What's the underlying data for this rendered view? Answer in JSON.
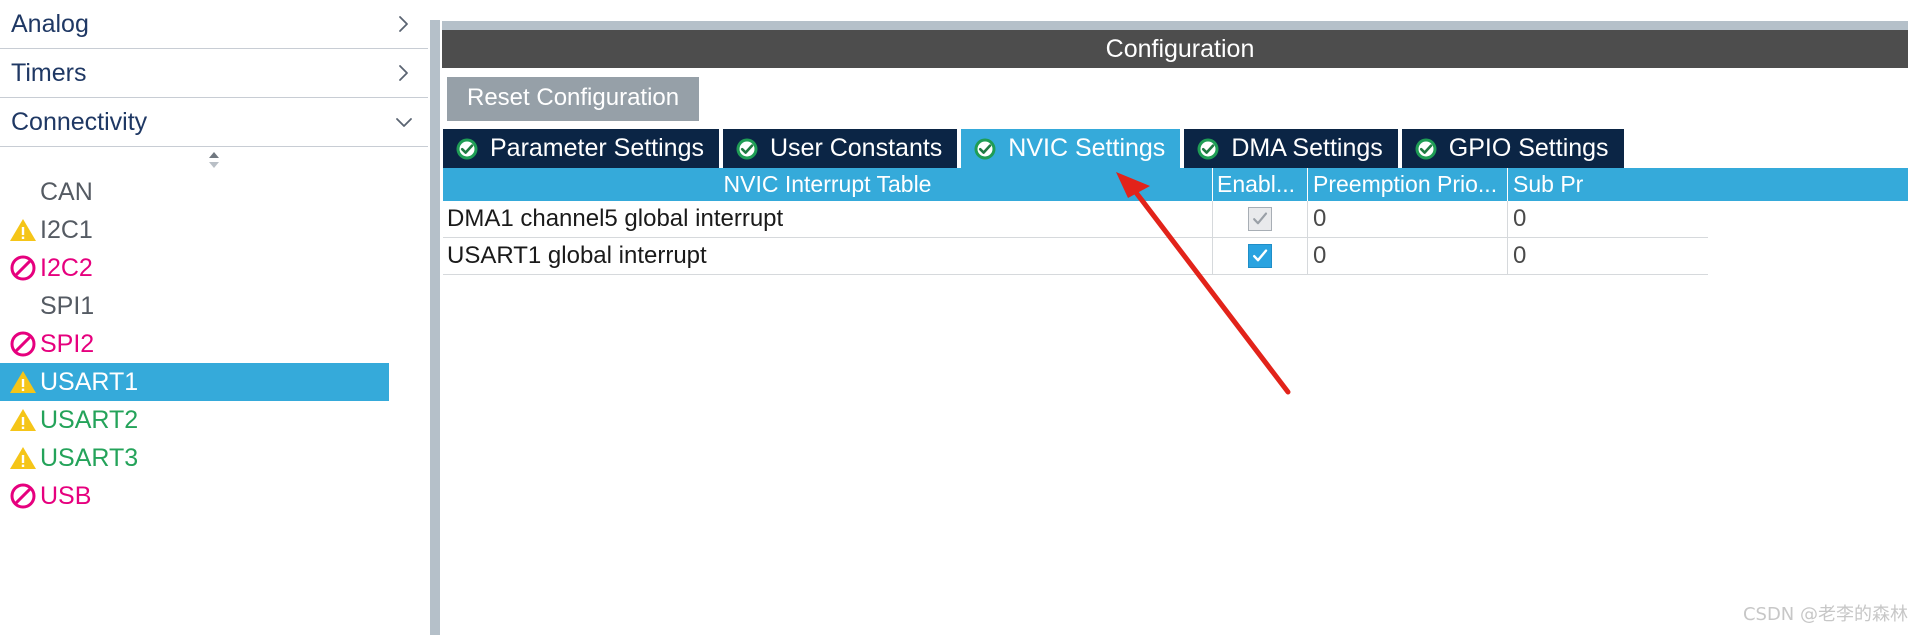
{
  "sidebar": {
    "categories": [
      {
        "label": "Analog",
        "expanded": false,
        "chevron": "chevron-right-icon"
      },
      {
        "label": "Timers",
        "expanded": false,
        "chevron": "chevron-right-icon"
      },
      {
        "label": "Connectivity",
        "expanded": true,
        "chevron": "chevron-down-icon"
      }
    ],
    "scroll_up_down_icon": "scroll-updown-icon",
    "peripherals": [
      {
        "label": "CAN",
        "status": "none",
        "icon": "",
        "selected": false
      },
      {
        "label": "I2C1",
        "status": "warning",
        "icon": "warning-icon",
        "selected": false
      },
      {
        "label": "I2C2",
        "status": "blocked",
        "icon": "blocked-icon",
        "selected": false
      },
      {
        "label": "SPI1",
        "status": "none",
        "icon": "",
        "selected": false
      },
      {
        "label": "SPI2",
        "status": "blocked",
        "icon": "blocked-icon",
        "selected": false
      },
      {
        "label": "USART1",
        "status": "warning",
        "icon": "warning-icon",
        "selected": true
      },
      {
        "label": "USART2",
        "status": "warning",
        "icon": "warning-icon",
        "selected": false
      },
      {
        "label": "USART3",
        "status": "warning",
        "icon": "warning-icon",
        "selected": false
      },
      {
        "label": "USB",
        "status": "blocked",
        "icon": "blocked-icon",
        "selected": false
      }
    ]
  },
  "panel": {
    "title": "Configuration",
    "reset_button": "Reset Configuration",
    "tabs": [
      {
        "label": "Parameter Settings",
        "icon": "check-circle-icon",
        "active": false
      },
      {
        "label": "User Constants",
        "icon": "check-circle-icon",
        "active": false
      },
      {
        "label": "NVIC Settings",
        "icon": "check-circle-icon",
        "active": true
      },
      {
        "label": "DMA Settings",
        "icon": "check-circle-icon",
        "active": false
      },
      {
        "label": "GPIO Settings",
        "icon": "check-circle-icon",
        "active": false
      }
    ],
    "table": {
      "headers": {
        "name": "NVIC Interrupt Table",
        "enabled": "Enabl...",
        "preemption": "Preemption Prio...",
        "sub": "Sub Pr"
      },
      "rows": [
        {
          "name": "DMA1 channel5 global interrupt",
          "enabled": true,
          "enabled_disabled_look": true,
          "preemption_priority": "0",
          "sub_priority": "0"
        },
        {
          "name": "USART1 global interrupt",
          "enabled": true,
          "enabled_disabled_look": false,
          "preemption_priority": "0",
          "sub_priority": "0"
        }
      ]
    }
  },
  "annotation": {
    "arrow": "red-arrow-pointer",
    "color": "#e2231a"
  },
  "watermark": "CSDN @老李的森林",
  "colors": {
    "accent_blue": "#35aada",
    "tab_dark": "#0b2545",
    "header_gray": "#4d4d4d",
    "button_gray": "#96a0a8",
    "warn_yellow": "#f5c518",
    "blocked_pink": "#e6007e",
    "ok_green": "#24a35a",
    "category_text": "#1f3864"
  }
}
